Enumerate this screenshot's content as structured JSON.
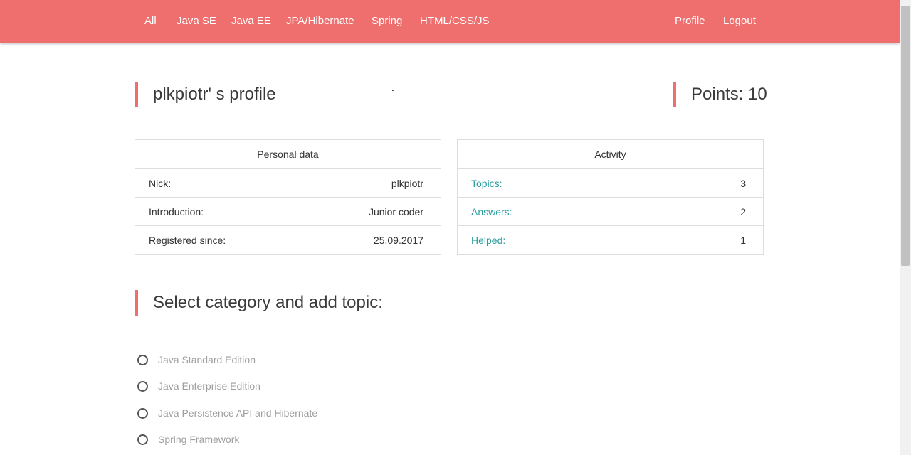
{
  "nav": {
    "left": [
      "All",
      "Java SE",
      "Java EE",
      "JPA/Hibernate",
      "Spring",
      "HTML/CSS/JS"
    ],
    "right": [
      "Profile",
      "Logout"
    ]
  },
  "profile": {
    "title": "plkpiotr' s profile",
    "points": "Points: 10"
  },
  "personal": {
    "header": "Personal data",
    "rows": [
      {
        "label": "Nick:",
        "value": "plkpiotr"
      },
      {
        "label": "Introduction:",
        "value": "Junior coder"
      },
      {
        "label": "Registered since:",
        "value": "25.09.2017"
      }
    ]
  },
  "activity": {
    "header": "Activity",
    "rows": [
      {
        "label": "Topics:",
        "value": "3"
      },
      {
        "label": "Answers:",
        "value": "2"
      },
      {
        "label": "Helped:",
        "value": "1"
      }
    ]
  },
  "category": {
    "heading": "Select category and add topic:",
    "options": [
      "Java Standard Edition",
      "Java Enterprise Edition",
      "Java Persistence API and Hibernate",
      "Spring Framework"
    ]
  },
  "colors": {
    "accent": "#ef6f6e",
    "link": "#2a9d9f"
  }
}
